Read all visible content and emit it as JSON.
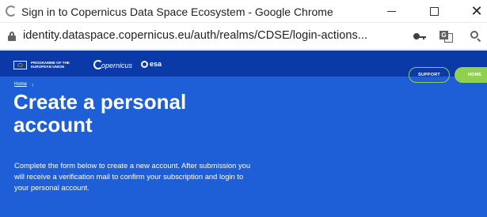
{
  "window": {
    "title": "Sign in to Copernicus Data Space Ecosystem - Google Chrome",
    "minimize": "",
    "maximize": "",
    "close": "✕"
  },
  "address_bar": {
    "url": "identity.dataspace.copernicus.eu/auth/realms/CDSE/login-actions...",
    "translate_glyph": "G"
  },
  "header": {
    "eu_label": "PROGRAMME OF THE EUROPEAN UNION",
    "copernicus_label": "opernicus",
    "esa_label": "esa",
    "support_label": "SUPPORT",
    "home_label": "HOME"
  },
  "breadcrumb": {
    "home": "Home",
    "separator": "›"
  },
  "main": {
    "title": "Create a personal account",
    "description": "Complete the form below to create a new account. After submission you will receive a verification mail to confirm your subscription and login to your personal account."
  },
  "colors": {
    "brand_blue": "#1e5fd8",
    "nav_blue": "#0b3aa8",
    "accent_green": "#8fd14f"
  }
}
